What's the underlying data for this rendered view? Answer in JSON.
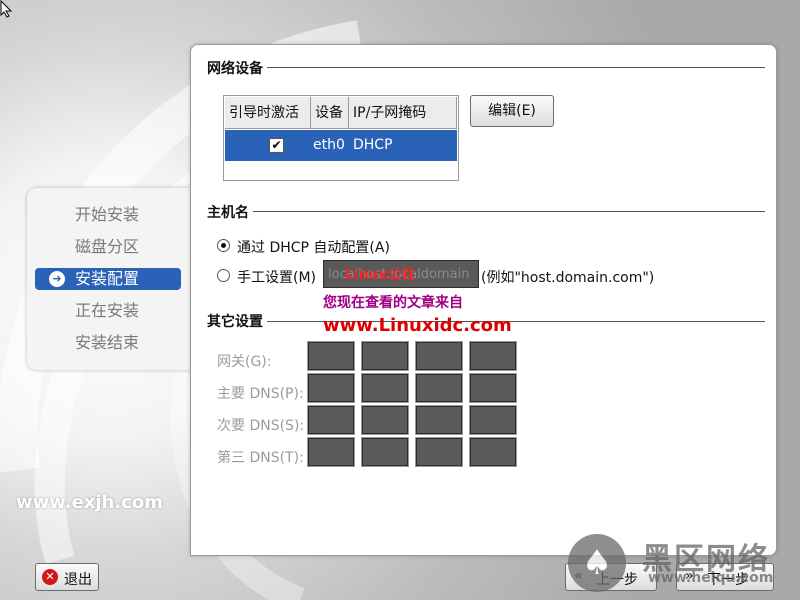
{
  "sidebar": {
    "steps": [
      {
        "label": "开始安装"
      },
      {
        "label": "磁盘分区"
      },
      {
        "label": "安装配置"
      },
      {
        "label": "正在安装"
      },
      {
        "label": "安装结束"
      }
    ],
    "active_index": 2
  },
  "site_mark": "www.exjh.com",
  "network": {
    "title": "网络设备",
    "columns": [
      "引导时激活",
      "设备",
      "IP/子网掩码"
    ],
    "rows": [
      {
        "active": true,
        "device": "eth0",
        "ip": "DHCP"
      }
    ],
    "edit_label": "编辑(E)"
  },
  "hostname": {
    "title": "主机名",
    "dhcp_label": "通过 DHCP 自动配置(A)",
    "dhcp_selected": true,
    "manual_label": "手工设置(M)",
    "manual_value": "localhost.localdomain",
    "example": "(例如\"host.domain.com\")"
  },
  "watermark": {
    "red": "Linux公社",
    "purple": "您现在查看的文章来自",
    "site": "www.Linuxidc.com"
  },
  "other": {
    "title": "其它设置",
    "gateway_label": "网关(G):",
    "primary_dns_label": "主要 DNS(P):",
    "secondary_dns_label": "次要 DNS(S):",
    "tertiary_dns_label": "第三 DNS(T):"
  },
  "footer": {
    "exit_label": "退出",
    "back_label": "上一步",
    "next_label": "下一步"
  },
  "corner_logo": {
    "big": "黑区网络",
    "small": "www.heiqu.com"
  },
  "colors": {
    "selection": "#2a62b8",
    "watermark_red": "#ff2222",
    "watermark_purple": "#a10085"
  }
}
